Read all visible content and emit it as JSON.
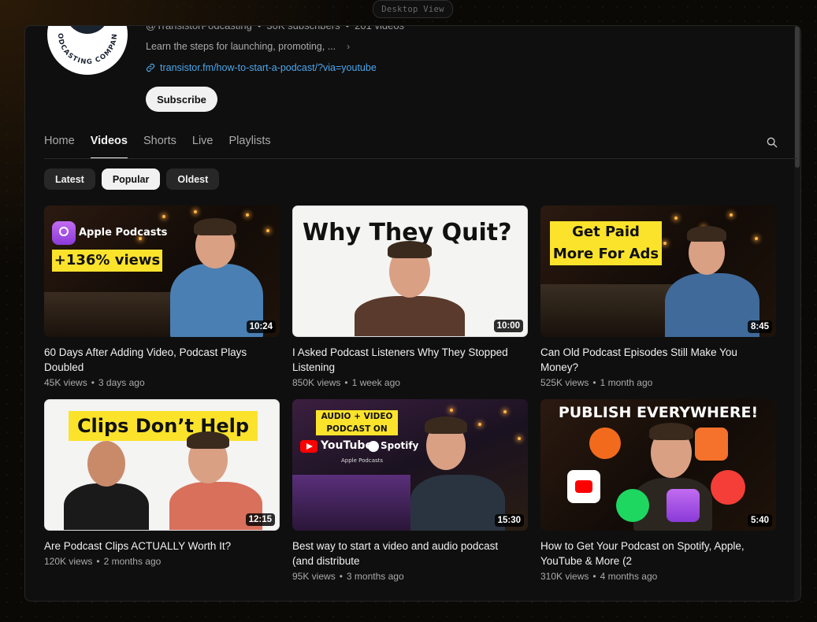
{
  "desktop_view_label": "Desktop View",
  "channel": {
    "handle": "@TransistorPodcasting",
    "subscribers": "30K subscribers",
    "videos_count": "201 videos",
    "description": "Learn the steps for launching, promoting, ...",
    "link": "transistor.fm/how-to-start-a-podcast/?via=youtube",
    "subscribe_label": "Subscribe",
    "logo_text": "PODCASTING COMPANY"
  },
  "tabs": [
    {
      "label": "Home",
      "active": false
    },
    {
      "label": "Videos",
      "active": true
    },
    {
      "label": "Shorts",
      "active": false
    },
    {
      "label": "Live",
      "active": false
    },
    {
      "label": "Playlists",
      "active": false
    }
  ],
  "chips": [
    {
      "label": "Latest",
      "active": false
    },
    {
      "label": "Popular",
      "active": true
    },
    {
      "label": "Oldest",
      "active": false
    }
  ],
  "videos": [
    {
      "title": "60 Days After Adding Video, Podcast Plays Doubled",
      "views": "45K views",
      "age": "3 days ago",
      "duration": "10:24",
      "thumb_text_1": "Apple Podcasts",
      "thumb_text_2": "+136% views"
    },
    {
      "title": "I Asked Podcast Listeners Why They Stopped Listening",
      "views": "850K views",
      "age": "1 week ago",
      "duration": "10:00",
      "thumb_text_1": "Why They Quit?"
    },
    {
      "title": "Can Old Podcast Episodes Still Make You Money?",
      "views": "525K views",
      "age": "1 month ago",
      "duration": "8:45",
      "thumb_text_1": "Get Paid",
      "thumb_text_2": "More For Ads"
    },
    {
      "title": "Are Podcast Clips ACTUALLY Worth It?",
      "views": "120K views",
      "age": "2 months ago",
      "duration": "12:15",
      "thumb_text_1": "Clips Don’t Help"
    },
    {
      "title": "Best way to start a video and audio podcast (and distribute",
      "views": "95K views",
      "age": "3 months ago",
      "duration": "15:30",
      "thumb_text_1": "AUDIO + VIDEO",
      "thumb_text_2": "PODCAST ON",
      "thumb_text_3": "YouTube",
      "thumb_text_4": "Spotify",
      "thumb_text_5": "Apple Podcasts"
    },
    {
      "title": "How to Get Your Podcast on Spotify, Apple, YouTube & More (2",
      "views": "310K views",
      "age": "4 months ago",
      "duration": "5:40",
      "thumb_text_1": "PUBLISH EVERYWHERE!"
    }
  ],
  "colors": {
    "link": "#4ea6ea",
    "highlight_yellow": "#fbe32c",
    "background": "#0f0f0f"
  }
}
